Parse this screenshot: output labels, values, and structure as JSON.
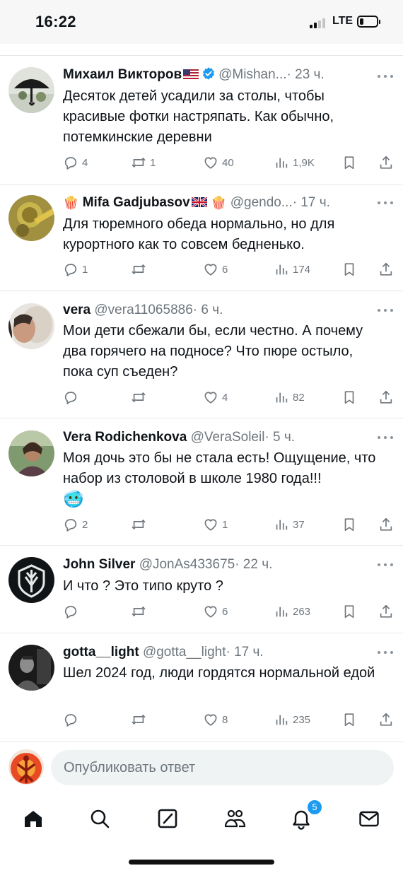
{
  "status_bar": {
    "time": "16:22",
    "network": "LTE",
    "battery_level": 0.18
  },
  "colors": {
    "accent": "#1d9bf0",
    "text_secondary": "#6e767d",
    "divider": "#e6e9eb"
  },
  "replies": [
    {
      "display_name": "Михаил Викторов",
      "flag": "us-flag",
      "verified": true,
      "handle": "@Mishan...",
      "time": "· 23 ч.",
      "text": "Десяток детей усадили за столы, чтобы красивые фотки настряпать. Как обычно, потемкинские деревни",
      "stats": {
        "replies": "4",
        "reposts": "1",
        "likes": "40",
        "views": "1,9K"
      }
    },
    {
      "display_name": "Mifa Gadjubasov",
      "prefix_emoji": "🍿",
      "suffix_emoji": "🍿",
      "flag": "gb-flag",
      "handle": "@gendo...",
      "time": "· 17 ч.",
      "text": "Для тюремного обеда нормально, но для курортного как то совсем бедненько.",
      "stats": {
        "replies": "1",
        "reposts": "",
        "likes": "6",
        "views": "174"
      }
    },
    {
      "display_name": "vera",
      "handle": "@vera11065886",
      "time": "· 6 ч.",
      "text": "Мои дети сбежали бы, если честно. А почему два горячего на подносе? Что пюре остыло, пока суп съеден?",
      "stats": {
        "replies": "",
        "reposts": "",
        "likes": "4",
        "views": "82"
      }
    },
    {
      "display_name": "Vera Rodichenkova",
      "handle": "@VeraSoleil",
      "time": "· 5 ч.",
      "text": "Моя дочь это бы не стала есть! Ощущение, что набор из столовой в школе 1980 года!!!",
      "trailing_emoji": "🥶",
      "stats": {
        "replies": "2",
        "reposts": "",
        "likes": "1",
        "views": "37"
      }
    },
    {
      "display_name": "John Silver",
      "handle": "@JonAs433675",
      "time": "· 22 ч.",
      "text": "И что ? Это типо круто ?",
      "stats": {
        "replies": "",
        "reposts": "",
        "likes": "6",
        "views": "263"
      }
    },
    {
      "display_name": "gotta__light",
      "handle": "@gotta__light",
      "time": "· 17 ч.",
      "text": "Шел 2024 год, люди гордятся нормальной едой",
      "stats": {
        "replies": "",
        "reposts": "",
        "likes": "8",
        "views": "235"
      }
    }
  ],
  "compose": {
    "placeholder": "Опубликовать ответ"
  },
  "tabbar": {
    "items": [
      "home-icon",
      "search-icon",
      "grok-icon",
      "communities-icon",
      "notifications-icon",
      "messages-icon"
    ],
    "notifications_badge": "5"
  }
}
